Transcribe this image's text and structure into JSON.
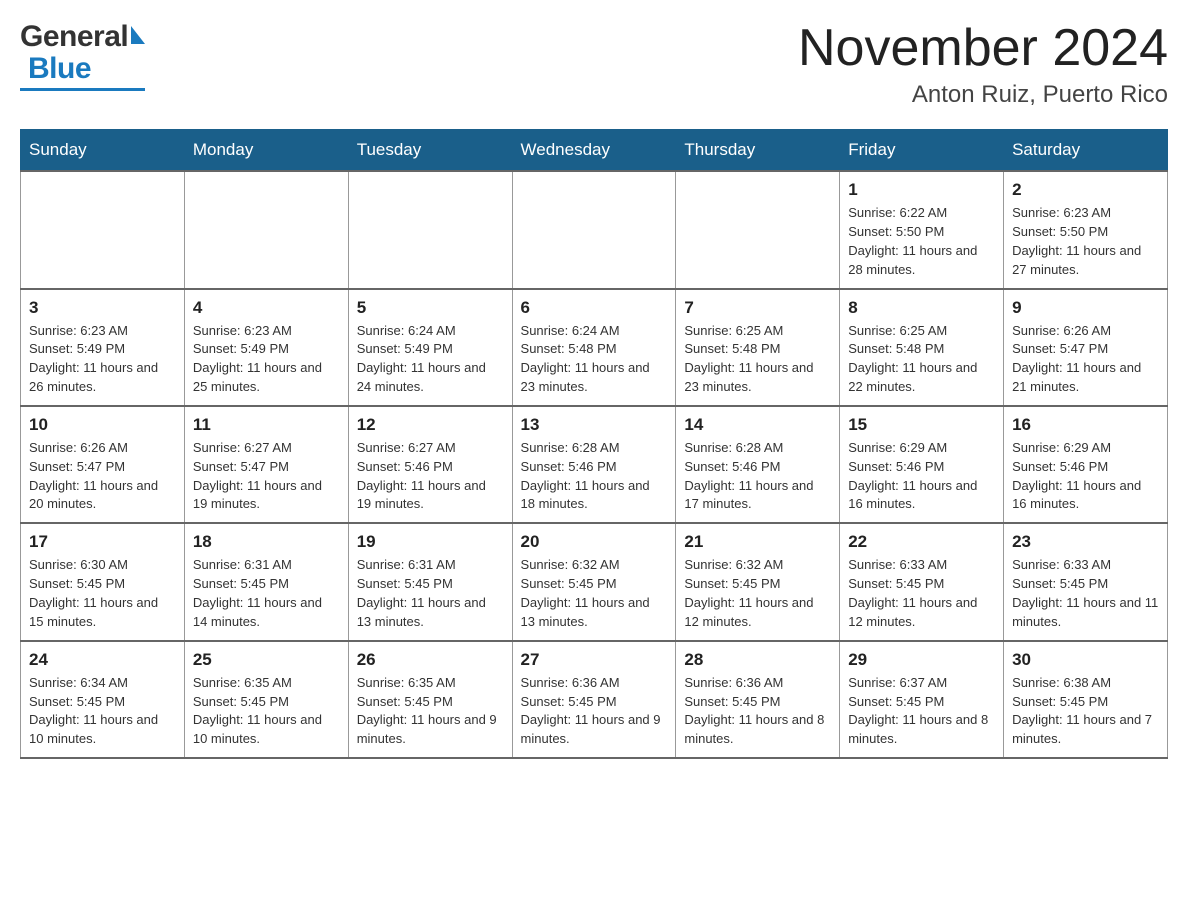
{
  "header": {
    "logo_general": "General",
    "logo_blue": "Blue",
    "month_year": "November 2024",
    "location": "Anton Ruiz, Puerto Rico"
  },
  "calendar": {
    "days_of_week": [
      "Sunday",
      "Monday",
      "Tuesday",
      "Wednesday",
      "Thursday",
      "Friday",
      "Saturday"
    ],
    "weeks": [
      {
        "days": [
          {
            "num": "",
            "info": "",
            "empty": true
          },
          {
            "num": "",
            "info": "",
            "empty": true
          },
          {
            "num": "",
            "info": "",
            "empty": true
          },
          {
            "num": "",
            "info": "",
            "empty": true
          },
          {
            "num": "",
            "info": "",
            "empty": true
          },
          {
            "num": "1",
            "info": "Sunrise: 6:22 AM\nSunset: 5:50 PM\nDaylight: 11 hours and 28 minutes."
          },
          {
            "num": "2",
            "info": "Sunrise: 6:23 AM\nSunset: 5:50 PM\nDaylight: 11 hours and 27 minutes."
          }
        ]
      },
      {
        "days": [
          {
            "num": "3",
            "info": "Sunrise: 6:23 AM\nSunset: 5:49 PM\nDaylight: 11 hours and 26 minutes."
          },
          {
            "num": "4",
            "info": "Sunrise: 6:23 AM\nSunset: 5:49 PM\nDaylight: 11 hours and 25 minutes."
          },
          {
            "num": "5",
            "info": "Sunrise: 6:24 AM\nSunset: 5:49 PM\nDaylight: 11 hours and 24 minutes."
          },
          {
            "num": "6",
            "info": "Sunrise: 6:24 AM\nSunset: 5:48 PM\nDaylight: 11 hours and 23 minutes."
          },
          {
            "num": "7",
            "info": "Sunrise: 6:25 AM\nSunset: 5:48 PM\nDaylight: 11 hours and 23 minutes."
          },
          {
            "num": "8",
            "info": "Sunrise: 6:25 AM\nSunset: 5:48 PM\nDaylight: 11 hours and 22 minutes."
          },
          {
            "num": "9",
            "info": "Sunrise: 6:26 AM\nSunset: 5:47 PM\nDaylight: 11 hours and 21 minutes."
          }
        ]
      },
      {
        "days": [
          {
            "num": "10",
            "info": "Sunrise: 6:26 AM\nSunset: 5:47 PM\nDaylight: 11 hours and 20 minutes."
          },
          {
            "num": "11",
            "info": "Sunrise: 6:27 AM\nSunset: 5:47 PM\nDaylight: 11 hours and 19 minutes."
          },
          {
            "num": "12",
            "info": "Sunrise: 6:27 AM\nSunset: 5:46 PM\nDaylight: 11 hours and 19 minutes."
          },
          {
            "num": "13",
            "info": "Sunrise: 6:28 AM\nSunset: 5:46 PM\nDaylight: 11 hours and 18 minutes."
          },
          {
            "num": "14",
            "info": "Sunrise: 6:28 AM\nSunset: 5:46 PM\nDaylight: 11 hours and 17 minutes."
          },
          {
            "num": "15",
            "info": "Sunrise: 6:29 AM\nSunset: 5:46 PM\nDaylight: 11 hours and 16 minutes."
          },
          {
            "num": "16",
            "info": "Sunrise: 6:29 AM\nSunset: 5:46 PM\nDaylight: 11 hours and 16 minutes."
          }
        ]
      },
      {
        "days": [
          {
            "num": "17",
            "info": "Sunrise: 6:30 AM\nSunset: 5:45 PM\nDaylight: 11 hours and 15 minutes."
          },
          {
            "num": "18",
            "info": "Sunrise: 6:31 AM\nSunset: 5:45 PM\nDaylight: 11 hours and 14 minutes."
          },
          {
            "num": "19",
            "info": "Sunrise: 6:31 AM\nSunset: 5:45 PM\nDaylight: 11 hours and 13 minutes."
          },
          {
            "num": "20",
            "info": "Sunrise: 6:32 AM\nSunset: 5:45 PM\nDaylight: 11 hours and 13 minutes."
          },
          {
            "num": "21",
            "info": "Sunrise: 6:32 AM\nSunset: 5:45 PM\nDaylight: 11 hours and 12 minutes."
          },
          {
            "num": "22",
            "info": "Sunrise: 6:33 AM\nSunset: 5:45 PM\nDaylight: 11 hours and 12 minutes."
          },
          {
            "num": "23",
            "info": "Sunrise: 6:33 AM\nSunset: 5:45 PM\nDaylight: 11 hours and 11 minutes."
          }
        ]
      },
      {
        "days": [
          {
            "num": "24",
            "info": "Sunrise: 6:34 AM\nSunset: 5:45 PM\nDaylight: 11 hours and 10 minutes."
          },
          {
            "num": "25",
            "info": "Sunrise: 6:35 AM\nSunset: 5:45 PM\nDaylight: 11 hours and 10 minutes."
          },
          {
            "num": "26",
            "info": "Sunrise: 6:35 AM\nSunset: 5:45 PM\nDaylight: 11 hours and 9 minutes."
          },
          {
            "num": "27",
            "info": "Sunrise: 6:36 AM\nSunset: 5:45 PM\nDaylight: 11 hours and 9 minutes."
          },
          {
            "num": "28",
            "info": "Sunrise: 6:36 AM\nSunset: 5:45 PM\nDaylight: 11 hours and 8 minutes."
          },
          {
            "num": "29",
            "info": "Sunrise: 6:37 AM\nSunset: 5:45 PM\nDaylight: 11 hours and 8 minutes."
          },
          {
            "num": "30",
            "info": "Sunrise: 6:38 AM\nSunset: 5:45 PM\nDaylight: 11 hours and 7 minutes."
          }
        ]
      }
    ]
  }
}
